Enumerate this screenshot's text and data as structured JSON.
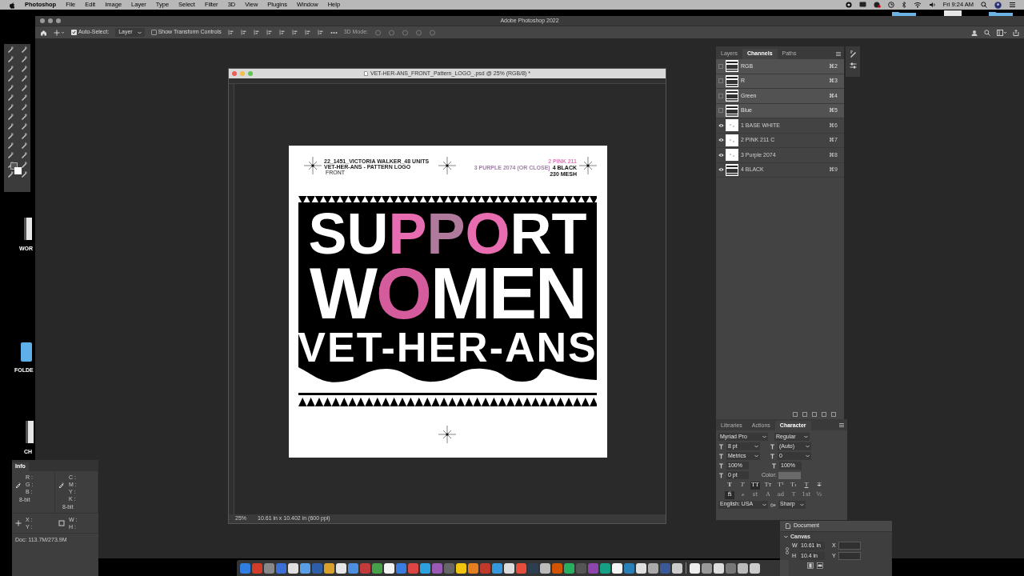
{
  "menu_bar": {
    "app": "Photoshop",
    "items": [
      "File",
      "Edit",
      "Image",
      "Layer",
      "Type",
      "Select",
      "Filter",
      "3D",
      "View",
      "Plugins",
      "Window",
      "Help"
    ],
    "clock": "Fri 9:24 AM"
  },
  "window": {
    "title": "Adobe Photoshop 2022"
  },
  "options_bar": {
    "auto_select": {
      "label": "Auto-Select:",
      "checked": true
    },
    "layer_dropdown": "Layer",
    "transform_controls": {
      "label": "Show Transform Controls",
      "checked": false
    },
    "mode_3d": "3D Mode:"
  },
  "desktop_icons": [
    {
      "label": "WOR",
      "kind": "document"
    },
    {
      "label": "FOLDE",
      "kind": "folder"
    },
    {
      "label": "CH",
      "kind": "document"
    }
  ],
  "document": {
    "title": "VET-HER-ANS_FRONT_Pattern_LOGO_.psd @ 25% (RGB/8) *",
    "zoom": "25%",
    "size": "10.61 in x 10.402 in (600 ppi)",
    "header": {
      "job": "22_1451_VICTORIA WALKER_48 UNITS",
      "name": "VET-HER-ANS - PATTERN LOGO",
      "side": "FRONT",
      "ink_lines": [
        [
          {
            "label": "2 PINK 211",
            "color": "#e07ab8"
          }
        ],
        [
          {
            "label": "3 PURPLE 2074 (OR CLOSE)",
            "color": "#a07fa8"
          },
          {
            "label": "4 BLACK",
            "color": "#111111"
          }
        ],
        [
          {
            "label": "230 MESH",
            "color": "#111111"
          }
        ]
      ]
    },
    "artwork_lines": [
      {
        "segments": [
          {
            "text": "SU",
            "color": "#ffffff"
          },
          {
            "text": "P",
            "color": "#e86db0"
          },
          {
            "text": "P",
            "color": "#b07a9c"
          },
          {
            "text": "O",
            "color": "#e86db0"
          },
          {
            "text": "RT",
            "color": "#ffffff"
          }
        ]
      },
      {
        "segments": [
          {
            "text": "W",
            "color": "#ffffff"
          },
          {
            "text": "O",
            "color": "#d45c9c"
          },
          {
            "text": "MEN",
            "color": "#ffffff"
          }
        ]
      },
      {
        "segments": [
          {
            "text": "VET-HER-ANS",
            "color": "#ffffff"
          }
        ]
      }
    ]
  },
  "channels_panel": {
    "tabs": [
      {
        "label": "Layers",
        "selected": false
      },
      {
        "label": "Channels",
        "selected": true
      },
      {
        "label": "Paths",
        "selected": false
      }
    ],
    "channels": [
      {
        "name": "RGB",
        "shortcut": "⌘2",
        "visible": false,
        "selected": true
      },
      {
        "name": "R",
        "shortcut": "⌘3",
        "visible": false,
        "selected": true
      },
      {
        "name": "Green",
        "shortcut": "⌘4",
        "visible": false,
        "selected": true
      },
      {
        "name": "Blue",
        "shortcut": "⌘5",
        "visible": false,
        "selected": true
      },
      {
        "name": "1 BASE WHITE",
        "shortcut": "⌘6",
        "visible": true,
        "selected": false
      },
      {
        "name": "2 PINK 211 C",
        "shortcut": "⌘7",
        "visible": true,
        "selected": false
      },
      {
        "name": "3 Purple 2074",
        "shortcut": "⌘8",
        "visible": true,
        "selected": false
      },
      {
        "name": "4 BLACK",
        "shortcut": "⌘9",
        "visible": true,
        "selected": false
      }
    ]
  },
  "character_panel": {
    "tabs": [
      {
        "label": "Libraries",
        "selected": false
      },
      {
        "label": "Actions",
        "selected": false
      },
      {
        "label": "Character",
        "selected": true
      }
    ],
    "font_family": "Myriad Pro",
    "font_style": "Regular",
    "size": "8 pt",
    "leading": "(Auto)",
    "kerning": "Metrics",
    "tracking": "0",
    "vertical_scale": "100%",
    "horizontal_scale": "100%",
    "baseline_shift": "0 pt",
    "color_label": "Color:",
    "style_buttons": [
      {
        "label": "T",
        "kind": "bold",
        "selected": false
      },
      {
        "label": "T",
        "kind": "italic",
        "selected": false
      },
      {
        "label": "TT",
        "kind": "plain",
        "selected": true
      },
      {
        "label": "Tт",
        "kind": "plain",
        "selected": false
      },
      {
        "label": "T¹",
        "kind": "plain",
        "selected": false
      },
      {
        "label": "T₁",
        "kind": "plain",
        "selected": false
      },
      {
        "label": "T",
        "kind": "underline",
        "selected": false
      },
      {
        "label": "T",
        "kind": "strike",
        "selected": false
      }
    ],
    "opentype_buttons": [
      {
        "label": "fi",
        "disabled": false,
        "selected": true
      },
      {
        "label": "ℴ",
        "disabled": true,
        "selected": false
      },
      {
        "label": "st",
        "disabled": true,
        "selected": false
      },
      {
        "label": "A",
        "disabled": true,
        "selected": false
      },
      {
        "label": "ad",
        "disabled": true,
        "selected": false
      },
      {
        "label": "T",
        "disabled": true,
        "selected": false
      },
      {
        "label": "1st",
        "disabled": true,
        "selected": false
      },
      {
        "label": "½",
        "disabled": true,
        "selected": false
      }
    ],
    "language": "English: USA",
    "antialias": "Sharp"
  },
  "properties_panel": {
    "section": "Document",
    "group": "Canvas",
    "w_label": "W",
    "width": "10.61 in",
    "x_label": "X",
    "h_label": "H",
    "height": "10.4 in",
    "y_label": "Y"
  },
  "info_panel": {
    "title": "Info",
    "rgb": [
      "R :",
      "G :",
      "B :"
    ],
    "rgb_depth": "8-bit",
    "cmyk": [
      "C :",
      "M :",
      "Y :",
      "K :"
    ],
    "cmyk_depth": "8-bit",
    "position": [
      "X :",
      "Y :"
    ],
    "size": [
      "W :",
      "H :"
    ],
    "doc": "Doc: 113.7M/273.9M"
  }
}
